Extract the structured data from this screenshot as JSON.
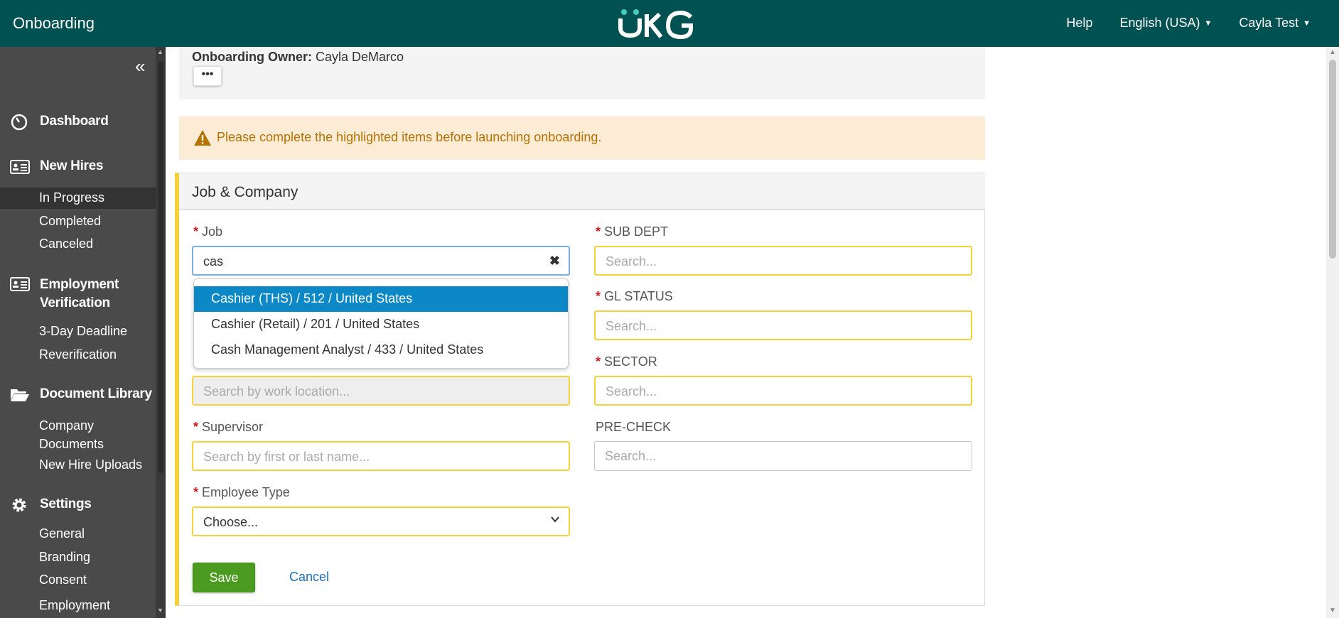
{
  "header": {
    "app_title": "Onboarding",
    "logo_text": "UKG",
    "help": "Help",
    "language": "English (USA)",
    "user": "Cayla Test"
  },
  "sidebar": {
    "sections": [
      {
        "label": "Dashboard",
        "icon": "dashboard-icon"
      },
      {
        "label": "New Hires",
        "icon": "id-card-icon",
        "items": [
          "In Progress",
          "Completed",
          "Canceled"
        ]
      },
      {
        "label": "Employment Verification",
        "icon": "id-card-icon",
        "items": [
          "3-Day Deadline",
          "Reverification"
        ]
      },
      {
        "label": "Document Library",
        "icon": "folder-icon",
        "items": [
          "Company Documents",
          "New Hire Uploads"
        ]
      },
      {
        "label": "Settings",
        "icon": "gear-icon",
        "items": [
          "General",
          "Branding",
          "Consent",
          "Employment Eligibility"
        ]
      }
    ],
    "active_item": "In Progress"
  },
  "owner": {
    "label": "Onboarding Owner:",
    "name": "Cayla DeMarco",
    "more_label": "•••"
  },
  "alert": {
    "message": "Please complete the highlighted items before launching onboarding."
  },
  "card": {
    "title": "Job & Company",
    "job": {
      "label": "Job",
      "value": "cas"
    },
    "job_options": [
      "Cashier (THS) / 512 / United States",
      "Cashier (Retail) / 201 / United States",
      "Cash Management Analyst / 433 / United States"
    ],
    "work_location": {
      "placeholder": "Search by work location..."
    },
    "supervisor": {
      "label": "Supervisor",
      "placeholder": "Search by first or last name..."
    },
    "employee_type": {
      "label": "Employee Type",
      "value": "Choose..."
    },
    "sub_dept": {
      "label": "SUB DEPT",
      "placeholder": "Search..."
    },
    "gl_status": {
      "label": "GL STATUS",
      "placeholder": "Search..."
    },
    "sector": {
      "label": "SECTOR",
      "placeholder": "Search..."
    },
    "pre_check": {
      "label": "PRE-CHECK",
      "placeholder": "Search..."
    },
    "save": "Save",
    "cancel": "Cancel"
  },
  "colors": {
    "header_bg": "#005151",
    "sidebar_bg": "#4a4a4a",
    "required_border": "#f6d13b",
    "selected_option": "#0b88c5",
    "save_button": "#4a9b1f",
    "alert_bg": "#fcebd5"
  }
}
